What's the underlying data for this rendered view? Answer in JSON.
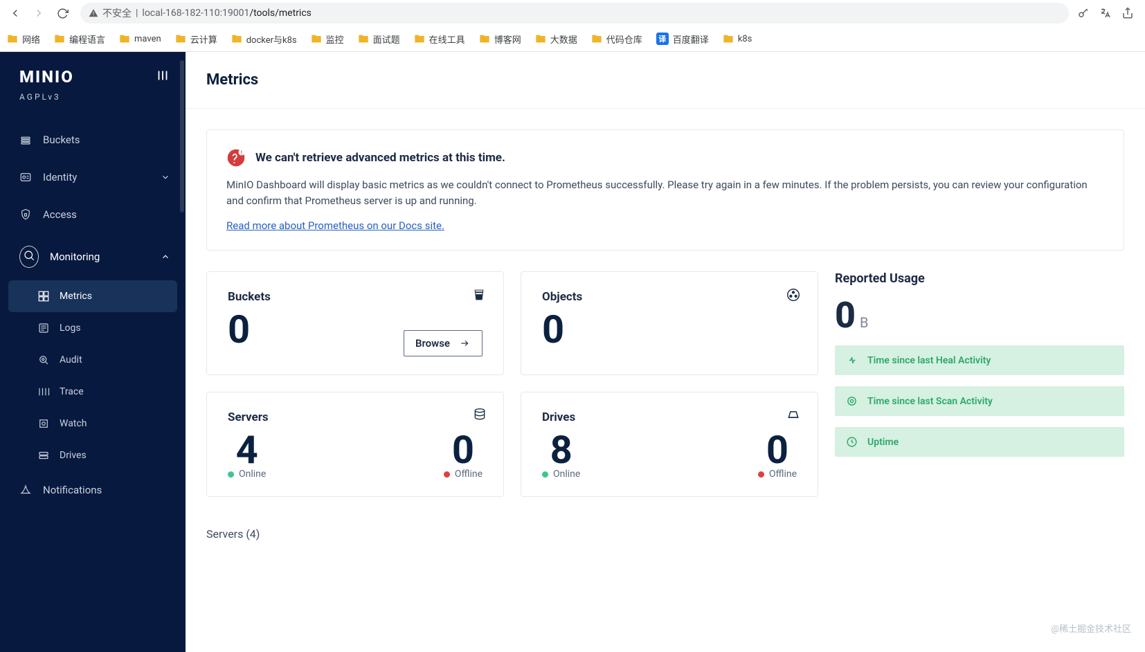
{
  "browser": {
    "insecure_label": "不安全",
    "url_host": "local-168-182-110:19001",
    "url_path": "/tools/metrics"
  },
  "bookmarks": [
    "网络",
    "编程语言",
    "maven",
    "云计算",
    "docker与k8s",
    "监控",
    "面试题",
    "在线工具",
    "博客网",
    "大数据",
    "代码仓库",
    "百度翻译",
    "k8s"
  ],
  "sidebar": {
    "brand": "MINIO",
    "license": "AGPLv3",
    "items": [
      {
        "label": "Buckets"
      },
      {
        "label": "Identity",
        "expandable": true
      },
      {
        "label": "Access"
      },
      {
        "label": "Monitoring",
        "expandable": true,
        "expanded": true,
        "children": [
          {
            "label": "Metrics",
            "active": true
          },
          {
            "label": "Logs"
          },
          {
            "label": "Audit"
          },
          {
            "label": "Trace"
          },
          {
            "label": "Watch"
          },
          {
            "label": "Drives"
          }
        ]
      },
      {
        "label": "Notifications"
      }
    ]
  },
  "page": {
    "title": "Metrics",
    "alert_title": "We can't retrieve advanced metrics at this time.",
    "alert_body": "MinIO Dashboard will display basic metrics as we couldn't connect to Prometheus successfully. Please try again in a few minutes. If the problem persists, you can review your configuration and confirm that Prometheus server is up and running.",
    "alert_link": "Read more about Prometheus on our Docs site.",
    "cards": {
      "buckets": {
        "title": "Buckets",
        "value": "0",
        "browse": "Browse"
      },
      "objects": {
        "title": "Objects",
        "value": "0"
      },
      "servers": {
        "title": "Servers",
        "online": "4",
        "online_label": "Online",
        "offline": "0",
        "offline_label": "Offline"
      },
      "drives": {
        "title": "Drives",
        "online": "8",
        "online_label": "Online",
        "offline": "0",
        "offline_label": "Offline"
      }
    },
    "usage": {
      "title": "Reported Usage",
      "value": "0",
      "unit": "B"
    },
    "activities": [
      {
        "label": "Time since last Heal Activity"
      },
      {
        "label": "Time since last Scan Activity"
      },
      {
        "label": "Uptime"
      }
    ],
    "servers_section": "Servers (4)"
  },
  "watermark": "@稀土掘金技术社区"
}
